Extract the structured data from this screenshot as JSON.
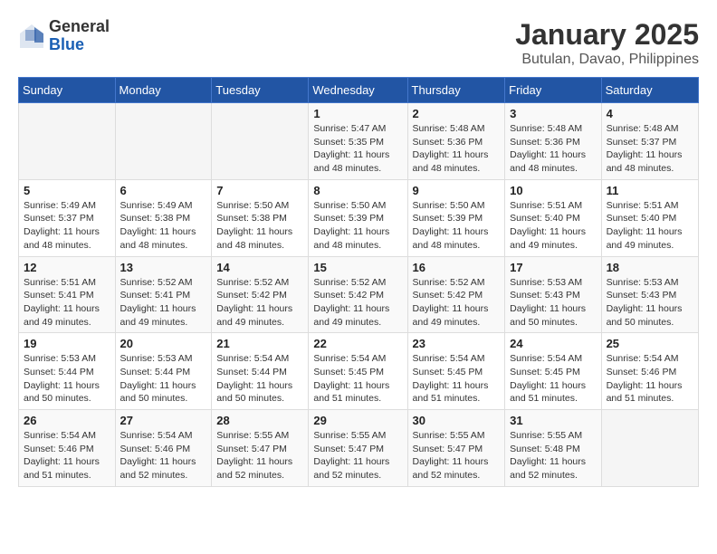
{
  "logo": {
    "general": "General",
    "blue": "Blue"
  },
  "title": "January 2025",
  "location": "Butulan, Davao, Philippines",
  "days_of_week": [
    "Sunday",
    "Monday",
    "Tuesday",
    "Wednesday",
    "Thursday",
    "Friday",
    "Saturday"
  ],
  "weeks": [
    [
      {
        "day": "",
        "info": ""
      },
      {
        "day": "",
        "info": ""
      },
      {
        "day": "",
        "info": ""
      },
      {
        "day": "1",
        "info": "Sunrise: 5:47 AM\nSunset: 5:35 PM\nDaylight: 11 hours and 48 minutes."
      },
      {
        "day": "2",
        "info": "Sunrise: 5:48 AM\nSunset: 5:36 PM\nDaylight: 11 hours and 48 minutes."
      },
      {
        "day": "3",
        "info": "Sunrise: 5:48 AM\nSunset: 5:36 PM\nDaylight: 11 hours and 48 minutes."
      },
      {
        "day": "4",
        "info": "Sunrise: 5:48 AM\nSunset: 5:37 PM\nDaylight: 11 hours and 48 minutes."
      }
    ],
    [
      {
        "day": "5",
        "info": "Sunrise: 5:49 AM\nSunset: 5:37 PM\nDaylight: 11 hours and 48 minutes."
      },
      {
        "day": "6",
        "info": "Sunrise: 5:49 AM\nSunset: 5:38 PM\nDaylight: 11 hours and 48 minutes."
      },
      {
        "day": "7",
        "info": "Sunrise: 5:50 AM\nSunset: 5:38 PM\nDaylight: 11 hours and 48 minutes."
      },
      {
        "day": "8",
        "info": "Sunrise: 5:50 AM\nSunset: 5:39 PM\nDaylight: 11 hours and 48 minutes."
      },
      {
        "day": "9",
        "info": "Sunrise: 5:50 AM\nSunset: 5:39 PM\nDaylight: 11 hours and 48 minutes."
      },
      {
        "day": "10",
        "info": "Sunrise: 5:51 AM\nSunset: 5:40 PM\nDaylight: 11 hours and 49 minutes."
      },
      {
        "day": "11",
        "info": "Sunrise: 5:51 AM\nSunset: 5:40 PM\nDaylight: 11 hours and 49 minutes."
      }
    ],
    [
      {
        "day": "12",
        "info": "Sunrise: 5:51 AM\nSunset: 5:41 PM\nDaylight: 11 hours and 49 minutes."
      },
      {
        "day": "13",
        "info": "Sunrise: 5:52 AM\nSunset: 5:41 PM\nDaylight: 11 hours and 49 minutes."
      },
      {
        "day": "14",
        "info": "Sunrise: 5:52 AM\nSunset: 5:42 PM\nDaylight: 11 hours and 49 minutes."
      },
      {
        "day": "15",
        "info": "Sunrise: 5:52 AM\nSunset: 5:42 PM\nDaylight: 11 hours and 49 minutes."
      },
      {
        "day": "16",
        "info": "Sunrise: 5:52 AM\nSunset: 5:42 PM\nDaylight: 11 hours and 49 minutes."
      },
      {
        "day": "17",
        "info": "Sunrise: 5:53 AM\nSunset: 5:43 PM\nDaylight: 11 hours and 50 minutes."
      },
      {
        "day": "18",
        "info": "Sunrise: 5:53 AM\nSunset: 5:43 PM\nDaylight: 11 hours and 50 minutes."
      }
    ],
    [
      {
        "day": "19",
        "info": "Sunrise: 5:53 AM\nSunset: 5:44 PM\nDaylight: 11 hours and 50 minutes."
      },
      {
        "day": "20",
        "info": "Sunrise: 5:53 AM\nSunset: 5:44 PM\nDaylight: 11 hours and 50 minutes."
      },
      {
        "day": "21",
        "info": "Sunrise: 5:54 AM\nSunset: 5:44 PM\nDaylight: 11 hours and 50 minutes."
      },
      {
        "day": "22",
        "info": "Sunrise: 5:54 AM\nSunset: 5:45 PM\nDaylight: 11 hours and 51 minutes."
      },
      {
        "day": "23",
        "info": "Sunrise: 5:54 AM\nSunset: 5:45 PM\nDaylight: 11 hours and 51 minutes."
      },
      {
        "day": "24",
        "info": "Sunrise: 5:54 AM\nSunset: 5:45 PM\nDaylight: 11 hours and 51 minutes."
      },
      {
        "day": "25",
        "info": "Sunrise: 5:54 AM\nSunset: 5:46 PM\nDaylight: 11 hours and 51 minutes."
      }
    ],
    [
      {
        "day": "26",
        "info": "Sunrise: 5:54 AM\nSunset: 5:46 PM\nDaylight: 11 hours and 51 minutes."
      },
      {
        "day": "27",
        "info": "Sunrise: 5:54 AM\nSunset: 5:46 PM\nDaylight: 11 hours and 52 minutes."
      },
      {
        "day": "28",
        "info": "Sunrise: 5:55 AM\nSunset: 5:47 PM\nDaylight: 11 hours and 52 minutes."
      },
      {
        "day": "29",
        "info": "Sunrise: 5:55 AM\nSunset: 5:47 PM\nDaylight: 11 hours and 52 minutes."
      },
      {
        "day": "30",
        "info": "Sunrise: 5:55 AM\nSunset: 5:47 PM\nDaylight: 11 hours and 52 minutes."
      },
      {
        "day": "31",
        "info": "Sunrise: 5:55 AM\nSunset: 5:48 PM\nDaylight: 11 hours and 52 minutes."
      },
      {
        "day": "",
        "info": ""
      }
    ]
  ]
}
